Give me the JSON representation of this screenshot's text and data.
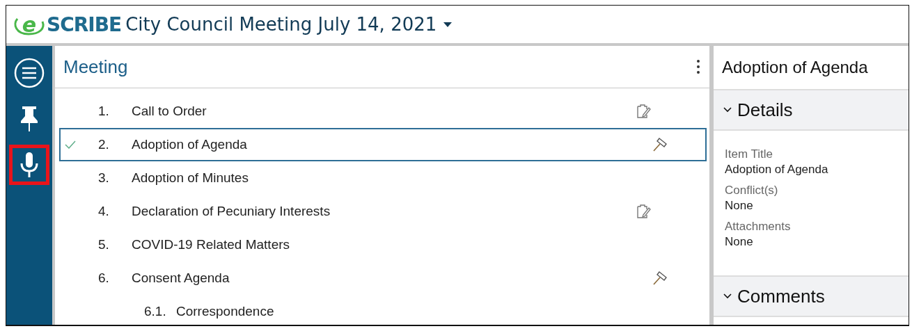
{
  "header": {
    "logo": {
      "mark": "e",
      "text": "SCRIBE"
    },
    "title": "City Council Meeting July 14, 2021"
  },
  "sidebar": {
    "items": [
      {
        "kind": "menu",
        "highlighted": false
      },
      {
        "kind": "pin",
        "highlighted": false
      },
      {
        "kind": "mic",
        "highlighted": true
      }
    ]
  },
  "agenda": {
    "title": "Meeting",
    "items": [
      {
        "number": "1.",
        "title": "Call to Order",
        "checked": false,
        "selected": false,
        "kind": "notes"
      },
      {
        "number": "2.",
        "title": "Adoption of Agenda",
        "checked": true,
        "selected": true,
        "kind": "gavel"
      },
      {
        "number": "3.",
        "title": "Adoption of Minutes",
        "checked": false,
        "selected": false,
        "kind": "plain"
      },
      {
        "number": "4.",
        "title": "Declaration of Pecuniary Interests",
        "checked": false,
        "selected": false,
        "kind": "notes"
      },
      {
        "number": "5.",
        "title": "COVID-19 Related Matters",
        "checked": false,
        "selected": false,
        "kind": "plain"
      },
      {
        "number": "6.",
        "title": "Consent Agenda",
        "checked": false,
        "selected": false,
        "kind": "gavel",
        "children": [
          {
            "number": "6.1.",
            "title": "Correspondence",
            "checked": false,
            "selected": false
          }
        ]
      }
    ]
  },
  "details": {
    "title": "Adoption of Agenda",
    "sections": [
      {
        "title": "Details",
        "expanded": true,
        "fields": [
          {
            "label": "Item Title",
            "value": "Adoption of Agenda"
          },
          {
            "label": "Conflict(s)",
            "value": "None"
          },
          {
            "label": "Attachments",
            "value": "None"
          }
        ]
      },
      {
        "title": "Comments",
        "expanded": true
      }
    ]
  }
}
